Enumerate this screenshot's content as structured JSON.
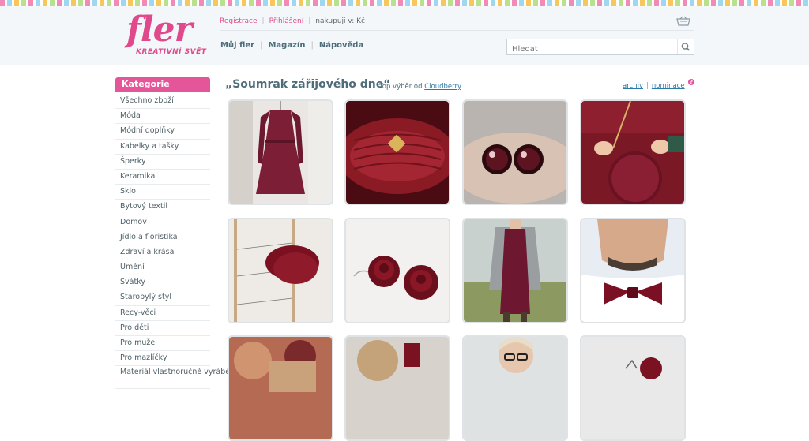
{
  "logo": {
    "word": "fler",
    "tagline": "KREATIVNÍ SVĚT"
  },
  "top_links": {
    "register": "Registrace",
    "login": "Přihlášení",
    "currency": "nakupuji v: Kč"
  },
  "main_nav": [
    "Můj fler",
    "Magazín",
    "Nápověda"
  ],
  "search": {
    "placeholder": "Hledat"
  },
  "sidebar": {
    "heading": "Kategorie",
    "items": [
      "Všechno zboží",
      "Móda",
      "Módní doplňky",
      "Kabelky a tašky",
      "Šperky",
      "Keramika",
      "Sklo",
      "Bytový textil",
      "Domov",
      "Jídlo a floristika",
      "Zdraví a krása",
      "Umění",
      "Svátky",
      "Starobylý styl",
      "Recy-věci",
      "Pro děti",
      "Pro muže",
      "Pro mazlíčky",
      "Materiál vlastnoručně vyráběný"
    ]
  },
  "collection": {
    "title": "„Soumrak zářijového dne“",
    "subtitle_prefix": "Top výběr od",
    "curator": "Cloudberry",
    "archive": "archiv",
    "nominate": "nominace",
    "help": "?"
  },
  "products": [
    {
      "name": "burgundy-dress-photo"
    },
    {
      "name": "knitted-headband-photo"
    },
    {
      "name": "glass-earrings-photo"
    },
    {
      "name": "round-handbag-photo"
    },
    {
      "name": "knitted-snood-photo"
    },
    {
      "name": "rose-earrings-photo"
    },
    {
      "name": "cardigan-outfit-photo"
    },
    {
      "name": "bow-tie-photo"
    },
    {
      "name": "painting-photo"
    },
    {
      "name": "jewelry-flatlay-photo"
    },
    {
      "name": "woman-glasses-photo"
    },
    {
      "name": "earring-detail-photo"
    }
  ],
  "colors": {
    "brand_pink": "#e04a8c",
    "nav_text": "#4d6d7a",
    "link_blue": "#2b7ba8"
  }
}
